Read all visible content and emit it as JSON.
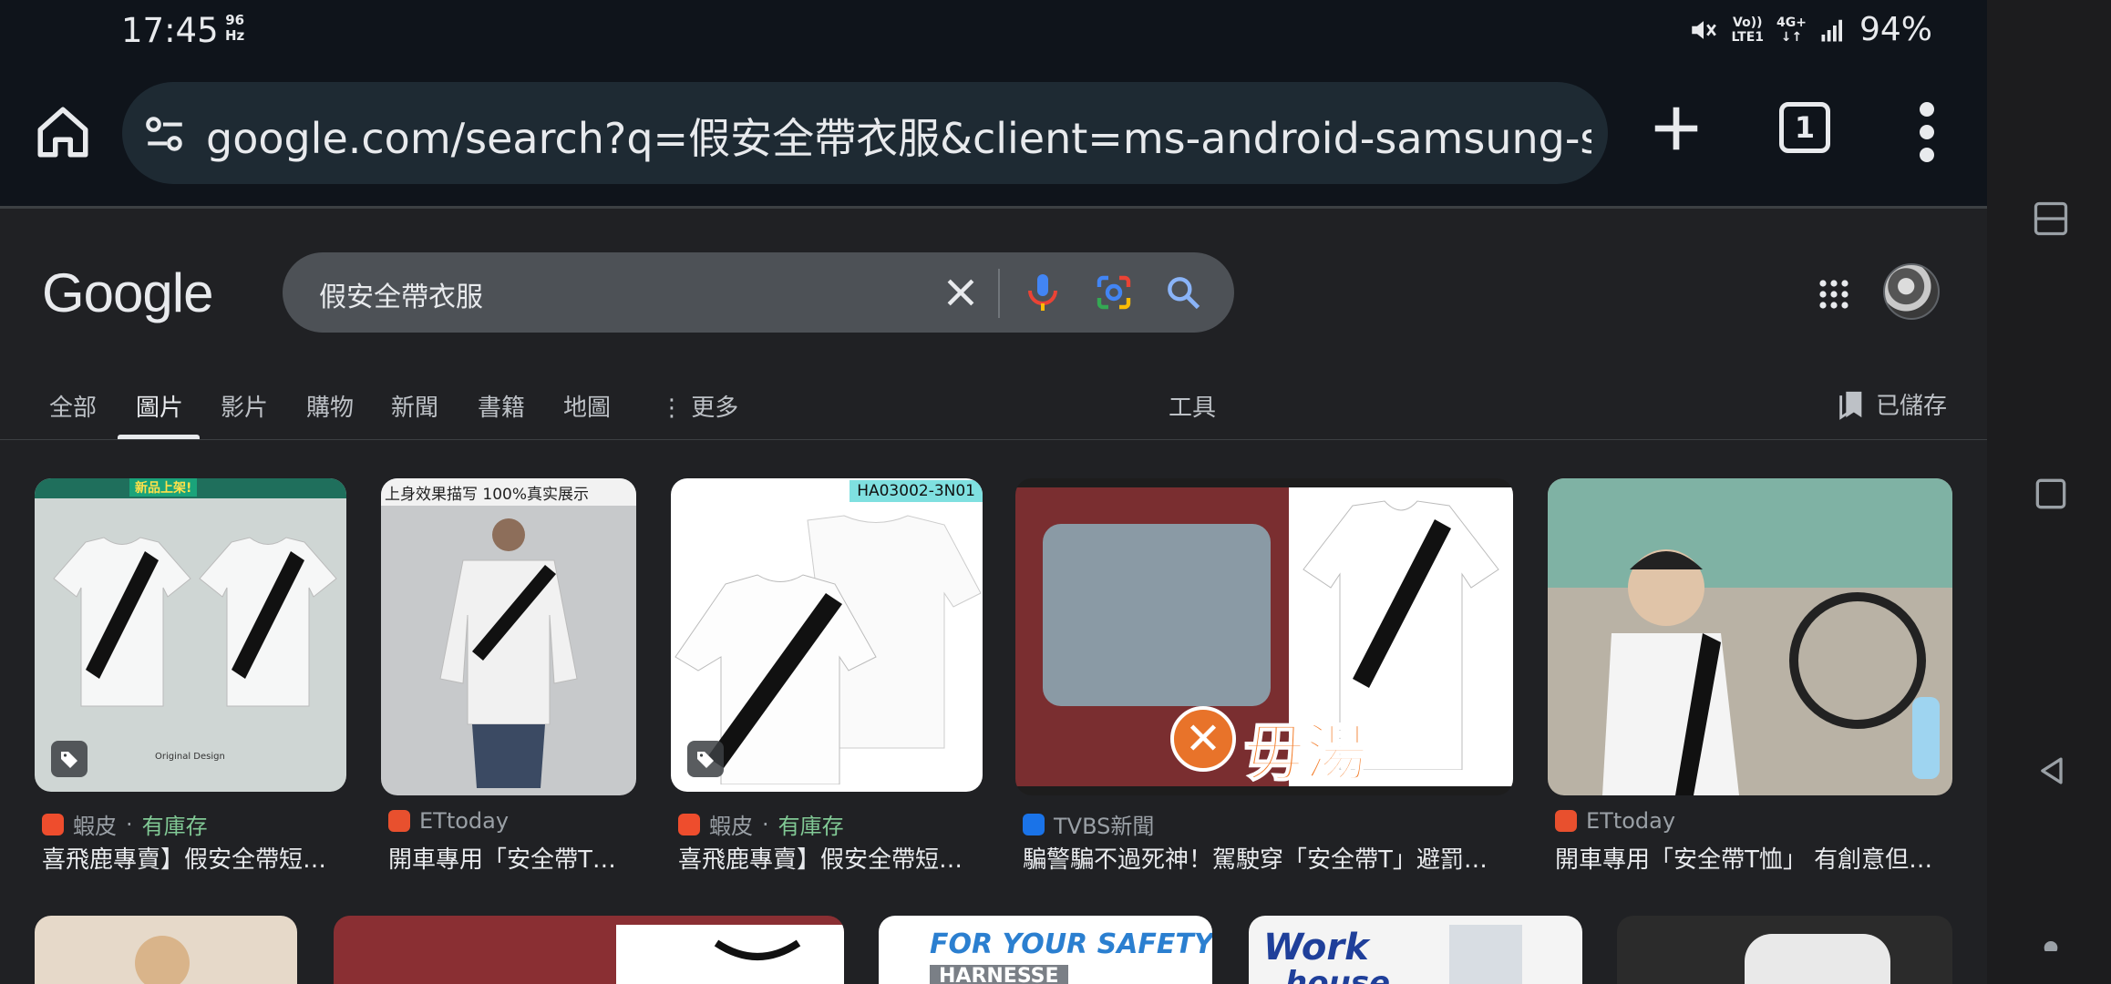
{
  "status_bar": {
    "time": "17:45",
    "refresh_top": "96",
    "refresh_bottom": "Hz",
    "network_top": "Vo))",
    "network_bottom": "LTE1",
    "gen": "4G+",
    "battery": "94%"
  },
  "browser": {
    "url": "google.com/search?q=假安全帶衣服&client=ms-android-samsung-ss&sca_",
    "tab_count": "1"
  },
  "google": {
    "logo": "Google",
    "query": "假安全帶衣服"
  },
  "tabs": [
    {
      "label": "全部"
    },
    {
      "label": "圖片",
      "active": true
    },
    {
      "label": "影片"
    },
    {
      "label": "購物"
    },
    {
      "label": "新聞"
    },
    {
      "label": "書籍"
    },
    {
      "label": "地圖"
    },
    {
      "label": "更多"
    }
  ],
  "tools_label": "工具",
  "saved_label": "已儲存",
  "results": [
    {
      "source": "蝦皮",
      "extra": "有庫存",
      "title": "喜飛鹿專賣】假安全帶短…",
      "favicon_color": "#ee4d2d",
      "overlay_left": "新品上架!",
      "overlay_bottom": "Original Design"
    },
    {
      "source": "ETtoday",
      "extra": "",
      "title": "開車專用「安全帶T…",
      "favicon_color": "#e8502e",
      "overlay_top": "上身效果描写 100%真实展示"
    },
    {
      "source": "蝦皮",
      "extra": "有庫存",
      "title": "喜飛鹿專賣】假安全帶短…",
      "favicon_color": "#ee4d2d",
      "overlay_code": "HA03002-3N01"
    },
    {
      "source": "TVBS新聞",
      "extra": "",
      "title": "騙警騙不過死神！駕駛穿「安全帶T」避罰…",
      "favicon_color": "#1a73e8",
      "overlay_caption": "毋湯"
    },
    {
      "source": "ETtoday",
      "extra": "",
      "title": "開車專用「安全帶T恤」 有創意但…",
      "favicon_color": "#e8502e"
    }
  ],
  "row2_texts": {
    "safety_top": "FOR YOUR SAFETY",
    "safety_bottom": "HARNESSE",
    "work_top": "Work",
    "work_bottom": "house"
  },
  "colors": {
    "accent_underline": "#e8eaed",
    "in_stock": "#81c995",
    "chrome_bg": "#0f141b",
    "page_bg": "#202124"
  }
}
